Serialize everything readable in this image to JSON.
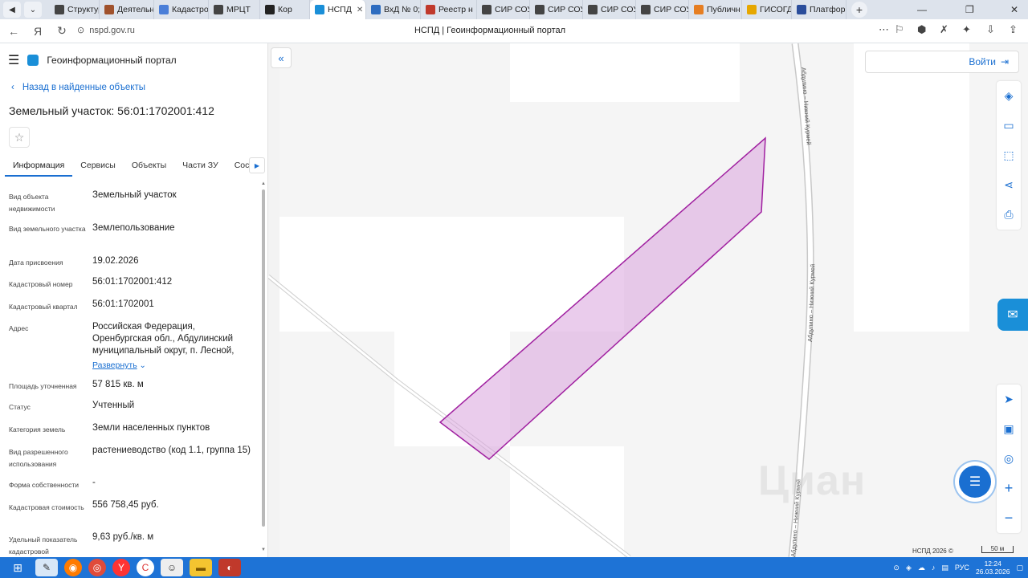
{
  "browser": {
    "tabs": [
      {
        "label": "Структур",
        "color": "#444"
      },
      {
        "label": "Деятельн",
        "color": "#a0522d"
      },
      {
        "label": "Кадастро",
        "color": "#4a7ed8"
      },
      {
        "label": "МРЦТ",
        "color": "#444"
      },
      {
        "label": "Кор",
        "color": "#222"
      },
      {
        "label": "НСПД",
        "color": "#1a8fd8",
        "active": true
      },
      {
        "label": "ВхД № 0;",
        "color": "#2d6cc0"
      },
      {
        "label": "Реестр н",
        "color": "#c0392b"
      },
      {
        "label": "СИР СОУ",
        "color": "#444"
      },
      {
        "label": "СИР СОУ",
        "color": "#444"
      },
      {
        "label": "СИР СОУ",
        "color": "#444"
      },
      {
        "label": "СИР СОУ",
        "color": "#444"
      },
      {
        "label": "Публичн",
        "color": "#e67e22"
      },
      {
        "label": "ГИСОГД",
        "color": "#e6a700"
      },
      {
        "label": "Платфор",
        "color": "#2a4d9b"
      }
    ],
    "url": "nspd.gov.ru",
    "page_title": "НСПД | Геоинформационный портал"
  },
  "panel": {
    "app_title": "Геоинформационный портал",
    "back_link": "Назад в найденные объекты",
    "object_title": "Земельный участок: 56:01:1702001:412",
    "tabs": [
      "Информация",
      "Сервисы",
      "Объекты",
      "Части ЗУ",
      "Состав"
    ],
    "properties": [
      {
        "label": "Вид объекта недвижимости",
        "value": "Земельный участок"
      },
      {
        "label": "Вид земельного участка",
        "value": "Землепользование"
      },
      {
        "label": "Дата присвоения",
        "value": "19.02.2026"
      },
      {
        "label": "Кадастровый номер",
        "value": "56:01:1702001:412"
      },
      {
        "label": "Кадастровый квартал",
        "value": "56:01:1702001"
      },
      {
        "label": "Адрес",
        "value": "Российская Федерация, Оренбургская обл., Абдулинский муниципальный округ, п. Лесной,",
        "more": "Развернуть"
      },
      {
        "label": "Площадь уточненная",
        "value": "57 815 кв. м"
      },
      {
        "label": "Статус",
        "value": "Учтенный"
      },
      {
        "label": "Категория земель",
        "value": "Земли населенных пунктов"
      },
      {
        "label": "Вид разрешенного использования",
        "value": "растениеводство (код 1.1, группа 15)"
      },
      {
        "label": "Форма собственности",
        "value": "-"
      },
      {
        "label": "Кадастровая стоимость",
        "value": "556 758,45 руб."
      },
      {
        "label": "Удельный показатель кадастровой",
        "value": "9,63 руб./кв. м"
      }
    ]
  },
  "map": {
    "login_label": "Войти",
    "road_labels": [
      "Абдулино – Нижний Курмей",
      "Абдулино – Нижний Курмей",
      "Абдулино – Нижний Курмей"
    ],
    "watermark": "Циан",
    "copyright": "НСПД 2026 ©",
    "scale_label": "50 м",
    "parcel_color": "#a020a0"
  },
  "taskbar": {
    "lang": "РУС",
    "time": "12:24",
    "date": "26.03.2026"
  }
}
